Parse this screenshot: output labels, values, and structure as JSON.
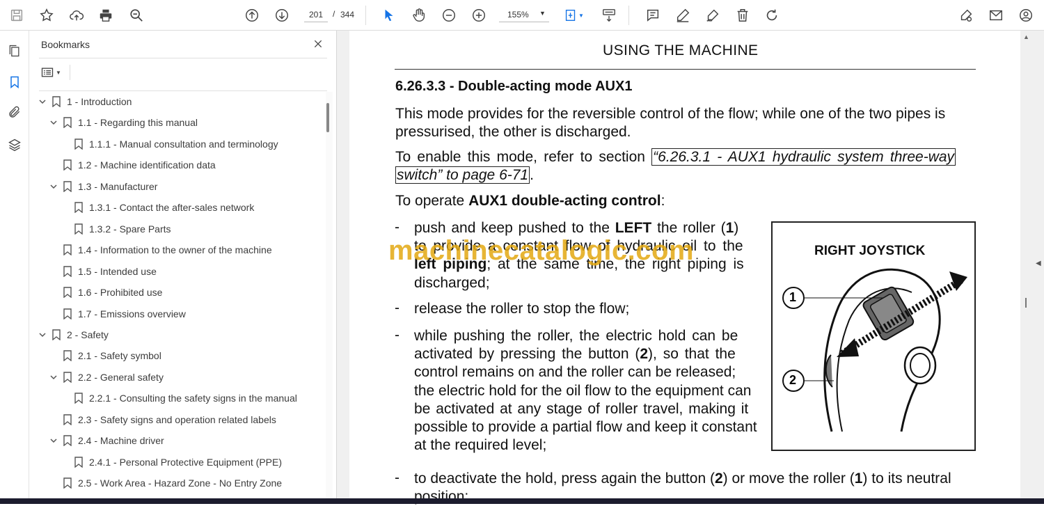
{
  "toolbar": {
    "current_page": "201",
    "page_separator": "/",
    "total_pages": "344",
    "zoom": "155%"
  },
  "panel": {
    "title": "Bookmarks"
  },
  "bookmarks": [
    {
      "label": "1 -  Introduction"
    },
    {
      "label": "1.1 - Regarding this manual"
    },
    {
      "label": "1.1.1 - Manual consultation and terminology"
    },
    {
      "label": "1.2 - Machine identification data"
    },
    {
      "label": "1.3 - Manufacturer"
    },
    {
      "label": "1.3.1 - Contact the after-sales network"
    },
    {
      "label": "1.3.2 - Spare Parts"
    },
    {
      "label": "1.4 - Information to the owner of the machine"
    },
    {
      "label": "1.5 - Intended use"
    },
    {
      "label": "1.6 - Prohibited use"
    },
    {
      "label": "1.7 - Emissions overview"
    },
    {
      "label": "2 -  Safety"
    },
    {
      "label": "2.1 - Safety symbol"
    },
    {
      "label": "2.2 - General safety"
    },
    {
      "label": "2.2.1 - Consulting the safety signs in the manual"
    },
    {
      "label": "2.3 - Safety signs and operation related labels"
    },
    {
      "label": "2.4 - Machine driver"
    },
    {
      "label": "2.4.1 - Personal Protective Equipment (PPE)"
    },
    {
      "label": "2.5 - Work Area - Hazard Zone - No Entry Zone"
    }
  ],
  "document": {
    "header": "USING THE MACHINE",
    "section_title": "6.26.3.3 - Double-acting mode AUX1",
    "para1_line1": "This mode provides for the reversible control of the flow; while one of the two pipes is",
    "para1_line2": "pressurised, the other is discharged.",
    "para2_prefix": "To enable this mode, refer to section ",
    "para2_link1": "“6.26.3.1 - AUX1 hydraulic system three-way",
    "para2_link2": "switch” to page 6-71",
    "para2_suffix": ".",
    "para3_prefix": "To operate ",
    "para3_bold": "AUX1 double-acting control",
    "para3_suffix": ":",
    "dash": "-",
    "item1_a": "push and keep pushed to the ",
    "item1_b": "LEFT",
    "item1_c": " the roller (",
    "item1_d": "1",
    "item1_e": ")",
    "item1_line2": "to provide a constant flow of hydraulic oil to the",
    "item1_line3_bold": "left piping",
    "item1_line3_rest": "; at the same time, the right piping is",
    "item1_line4": "discharged;",
    "item2": "release the roller to stop the flow;",
    "item3_line1": "while pushing the roller, the electric hold can be",
    "item3_line2a": "activated by pressing the button (",
    "item3_line2b": "2",
    "item3_line2c": "), so that the",
    "item3_line3": "control remains on and the roller can be released;",
    "item3_line4": "the electric hold for the oil flow to the equipment can",
    "item3_line5": "be activated at any stage of roller travel, making it",
    "item3_line6": "possible to provide a partial flow and keep it constant",
    "item3_line7": "at the required level;",
    "item4_a": "to deactivate the hold, press again the button (",
    "item4_b": "2",
    "item4_c": ") or move the roller (",
    "item4_d": "1",
    "item4_e": ") to its neutral",
    "item4_line2": "position;"
  },
  "figure": {
    "title": "RIGHT JOYSTICK",
    "callout1": "1",
    "callout2": "2"
  },
  "watermark": "machinecatalogic.com"
}
